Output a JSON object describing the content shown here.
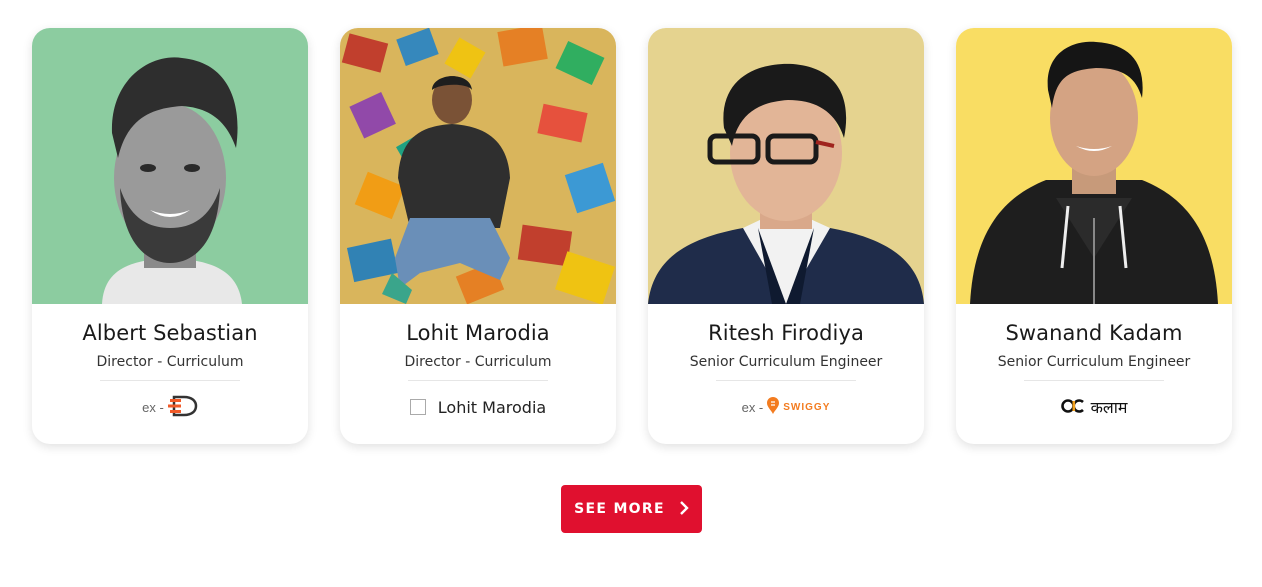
{
  "instructors": [
    {
      "name": "Albert Sebastian",
      "role": "Director - Curriculum",
      "company_prefix": "ex -",
      "company_logo": "lightning-E-logo",
      "photo_bg": "#8ccca0"
    },
    {
      "name": "Lohit Marodia",
      "role": "Director - Curriculum",
      "company_alt": "Lohit Marodia",
      "photo_bg": "#d8b45a"
    },
    {
      "name": "Ritesh Firodiya",
      "role": "Senior Curriculum Engineer",
      "company_prefix": "ex -",
      "company_brand": "SWIGGY",
      "company_logo": "swiggy-logo",
      "photo_bg": "#e5d38f"
    },
    {
      "name": "Swanand Kadam",
      "role": "Senior Curriculum Engineer",
      "company_brand": "कलाम",
      "company_logo": "ac-logo",
      "photo_bg": "#f9dd63"
    }
  ],
  "see_more": {
    "label": "SEE MORE",
    "icon": "chevron-right-icon",
    "color": "#e0102f"
  }
}
